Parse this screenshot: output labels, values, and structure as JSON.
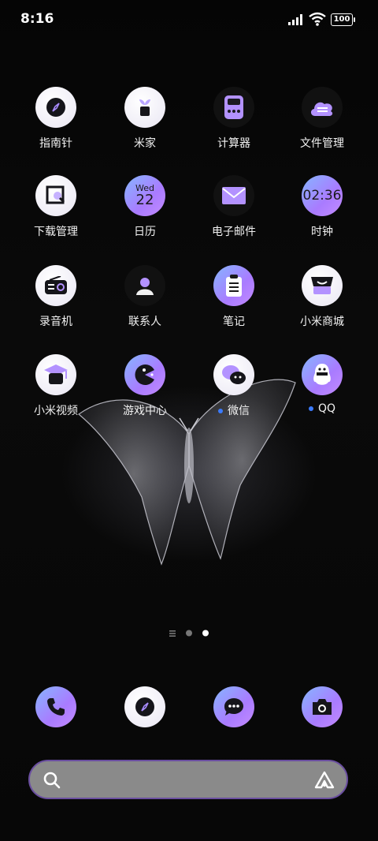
{
  "status_bar": {
    "time": "8:16",
    "battery": "100"
  },
  "apps": [
    {
      "label": "指南针",
      "icon": "compass-icon"
    },
    {
      "label": "米家",
      "icon": "plant-pot-icon"
    },
    {
      "label": "计算器",
      "icon": "calculator-icon"
    },
    {
      "label": "文件管理",
      "icon": "cloud-files-icon"
    },
    {
      "label": "下载管理",
      "icon": "download-magnifier-icon"
    },
    {
      "label": "日历",
      "icon": "calendar-icon",
      "day": "Wed",
      "date": "22"
    },
    {
      "label": "电子邮件",
      "icon": "mail-icon"
    },
    {
      "label": "时钟",
      "icon": "clock-icon",
      "clock": "02:36"
    },
    {
      "label": "录音机",
      "icon": "radio-icon"
    },
    {
      "label": "联系人",
      "icon": "contact-person-icon"
    },
    {
      "label": "笔记",
      "icon": "notepad-icon"
    },
    {
      "label": "小米商城",
      "icon": "shop-icon"
    },
    {
      "label": "小米视频",
      "icon": "video-cap-icon"
    },
    {
      "label": "游戏中心",
      "icon": "game-pacman-icon"
    },
    {
      "label": "微信",
      "icon": "wechat-icon",
      "notification": true
    },
    {
      "label": "QQ",
      "icon": "qq-penguin-icon",
      "notification": true
    }
  ],
  "dock": [
    {
      "name": "phone",
      "icon": "phone-icon"
    },
    {
      "name": "browser",
      "icon": "compass-icon"
    },
    {
      "name": "messages",
      "icon": "chat-bubble-icon"
    },
    {
      "name": "camera",
      "icon": "camera-icon"
    }
  ],
  "pager": {
    "pages": 2,
    "current": 2
  },
  "colors": {
    "accent_purple": "#a97bff",
    "accent_blue": "#86b6ff",
    "notify_dot": "#3b7bff"
  }
}
